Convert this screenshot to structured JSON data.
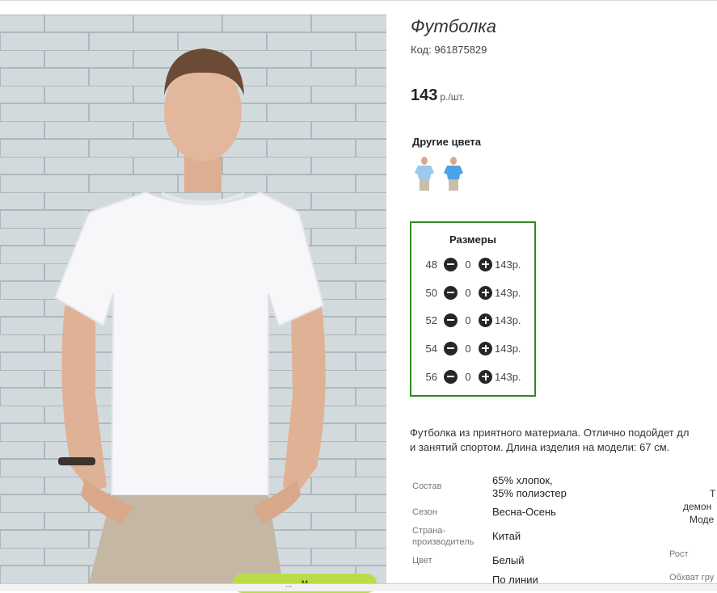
{
  "product": {
    "title": "Футболка",
    "code": "Код: 961875829",
    "price": "143",
    "price_unit": "р./шт.",
    "other_colors_label": "Другие цвета",
    "color_swatches": [
      {
        "name": "light-blue",
        "color": "#9cc8ea"
      },
      {
        "name": "blue",
        "color": "#4aa3e6"
      }
    ],
    "cart_button_label": "м"
  },
  "sizes": {
    "title": "Размеры",
    "rows": [
      {
        "size": "48",
        "qty": "0",
        "price": "143р."
      },
      {
        "size": "50",
        "qty": "0",
        "price": "143р."
      },
      {
        "size": "52",
        "qty": "0",
        "price": "143р."
      },
      {
        "size": "54",
        "qty": "0",
        "price": "143р."
      },
      {
        "size": "56",
        "qty": "0",
        "price": "143р."
      }
    ],
    "border_color": "#2e8b1e"
  },
  "description": {
    "line1": "Футболка из приятного материала. Отлично подойдет дл",
    "line2": "и занятий спортом. Длина изделия на модели: 67 см."
  },
  "specs": [
    {
      "label": "Состав",
      "value_line1": "65% хлопок,",
      "value_line2": "35% полиэстер"
    },
    {
      "label": "Сезон",
      "value_line1": "Весна-Осень"
    },
    {
      "label": "Страна-\nпроизводитель",
      "label_line1": "Страна-",
      "label_line2": "производитель",
      "value_line1": "Китай"
    },
    {
      "label": "Цвет",
      "value_line1": "Белый"
    },
    {
      "label": "",
      "value_line1": "По линии"
    }
  ],
  "right_column": {
    "t": "Т",
    "demon": "демон",
    "mode": "Моде",
    "height_label": "Рост",
    "chest_label": "Обхват гру"
  },
  "bottom_grip": "'''"
}
